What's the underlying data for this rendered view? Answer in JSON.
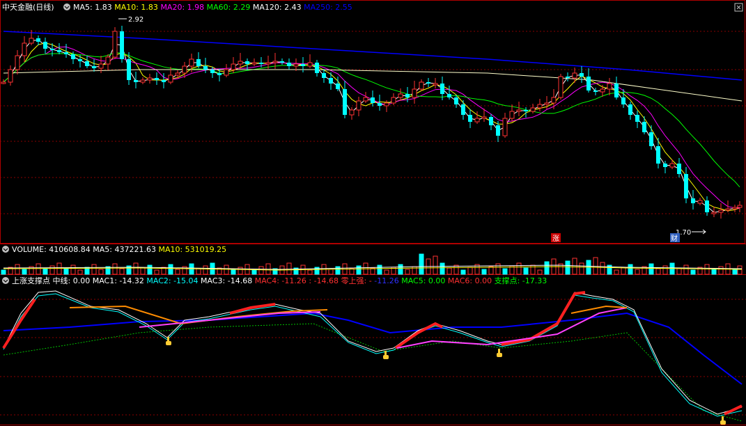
{
  "main_panel": {
    "title": "中天金融(日线)",
    "indicators": [
      {
        "label": "MA5: 1.83",
        "color": "#ffffff"
      },
      {
        "label": "MA10: 1.83",
        "color": "#ffff00"
      },
      {
        "label": "MA20: 1.98",
        "color": "#ff00ff"
      },
      {
        "label": "MA60: 2.29",
        "color": "#00ff00"
      },
      {
        "label": "MA120: 2.43",
        "color": "#ffffff"
      },
      {
        "label": "MA250: 2.55",
        "color": "#0000ff"
      }
    ],
    "high_annotation": "2.92",
    "low_annotation": "1.70",
    "badge_zhang": "涨",
    "badge_cai": "财"
  },
  "volume_panel": {
    "indicators": [
      {
        "label": "VOLUME: 410608.84",
        "color": "#ffffff"
      },
      {
        "label": "MA5: 437221.63",
        "color": "#ffffff"
      },
      {
        "label": "MA10: 531019.25",
        "color": "#ffff00"
      }
    ]
  },
  "indicator_panel": {
    "indicators": [
      {
        "label": "上涨支撑点",
        "color": "#ffffff"
      },
      {
        "label": "中线: 0.00",
        "color": "#ffffff"
      },
      {
        "label": "MAC1: -14.32",
        "color": "#ffffff"
      },
      {
        "label": "MAC2: -15.04",
        "color": "#00ffff"
      },
      {
        "label": "MAC3: -14.68",
        "color": "#ffffff"
      },
      {
        "label": "MAC4: -11.26",
        "color": "#ff3030"
      },
      {
        "label": ": -14.68",
        "color": "#ff3030"
      },
      {
        "label": "零上强: -",
        "color": "#ff3030"
      },
      {
        "label": "-11.26",
        "color": "#3030ff"
      },
      {
        "label": "MAC5: 0.00",
        "color": "#00ff00"
      },
      {
        "label": "MAC6: 0.00",
        "color": "#ff3030"
      },
      {
        "label": "支撑点: -17.33",
        "color": "#00ff00"
      }
    ]
  },
  "colors": {
    "up": "#ff3232",
    "down": "#00ffff",
    "grid": "#8b0000",
    "frame": "#b00000"
  }
}
